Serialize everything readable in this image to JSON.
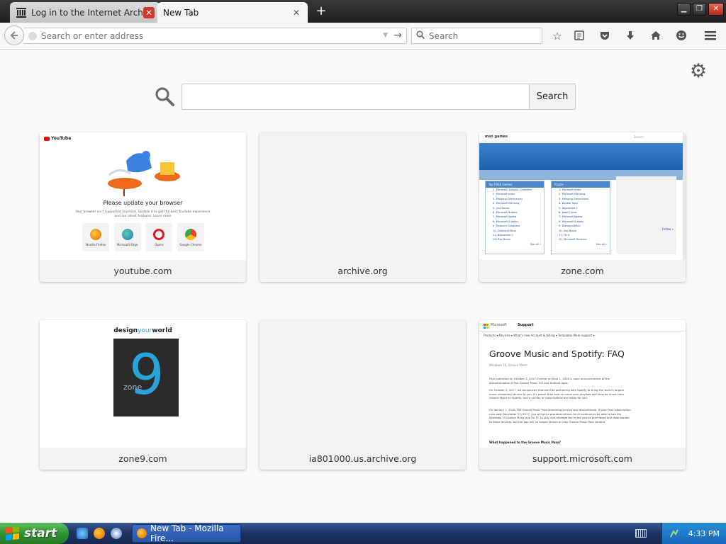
{
  "window": {
    "tabs": [
      {
        "label": "Log in to the Internet Archive",
        "icon": "archive-building-icon",
        "active": false
      },
      {
        "label": "New Tab",
        "icon": null,
        "active": true
      }
    ],
    "controls": {
      "minimize": "minimize-icon",
      "maximize": "restore-icon",
      "close": "close-icon"
    }
  },
  "toolbar": {
    "url_placeholder": "Search or enter address",
    "search_placeholder": "Search",
    "icons": [
      "back-arrow-icon",
      "bookmark-star-icon",
      "reading-list-icon",
      "pocket-icon",
      "downloads-icon",
      "home-icon",
      "hello-icon",
      "hamburger-menu-icon"
    ]
  },
  "newtab": {
    "search_button": "Search",
    "settings_icon": "gear-icon",
    "tiles": [
      {
        "title": "youtube.com"
      },
      {
        "title": "archive.org"
      },
      {
        "title": "zone.com"
      },
      {
        "title": "zone9.com"
      },
      {
        "title": "ia801000.us.archive.org"
      },
      {
        "title": "support.microsoft.com"
      }
    ],
    "youtube_thumb": {
      "brand": "YouTube",
      "heading": "Please update your browser",
      "sub": "Your browser isn't supported anymore. Update it to get the best YouTube experience and our latest features. Learn more",
      "browsers": [
        "Mozilla Firefox",
        "Microsoft Edge",
        "Opera",
        "Google Chrome"
      ]
    },
    "zone_thumb": {
      "logo": "msn games",
      "search": "Search",
      "col1_head": "Top FREE Games",
      "col1_items": [
        "1. Microsoft Solitaire Collection",
        "2. Microsoft Jewel",
        "3. Mahjong Dimensions",
        "4. Microsoft Mahjong",
        "5. Just Words",
        "6. Microsoft Bubble",
        "7. Microsoft Jigsaw",
        "8. Microsoft Sudoku",
        "9. Treasure Conquest",
        "10. Diamond Mine",
        "11. Bejeweled 2",
        "12. Zoo Boom"
      ],
      "col1_more": "See all »",
      "col2_head": "Puzzle",
      "col2_items": [
        "1. Microsoft Jewel",
        "2. Microsoft Mahjong",
        "3. Mahjong Dimensions",
        "4. Bubble Town",
        "5. Bejeweled 2",
        "6. Jewel Quest",
        "7. Microsoft Jigsaw",
        "8. Microsoft Sudoku",
        "9. Diamond Mine",
        "10. Zoo Boom",
        "11. Fill it",
        "12. Microsoft Treasure"
      ],
      "col2_more": "See all »",
      "side_link": "Follow »"
    },
    "zone9_thumb": {
      "title_a": "design",
      "title_b": "your",
      "title_c": "world",
      "nine": "9",
      "zone": "zone"
    },
    "ms_thumb": {
      "brand": "Microsoft",
      "section": "Support",
      "nav": "Products ▾   Devices ▾   What's new   Account & billing ▾   Templates   More support ▾",
      "title": "Groove Music and Spotify: FAQ",
      "meta": "Windows 10, Groove Music",
      "p1": "First published on October 2, 2017. Further on June 1, 2018 & upon announcement of the discontinuation of the Groove Music iOS and Android apps.",
      "p2": "On October 2, 2017, we announced that we'd be partnering with Spotify to bring the world's largest music streaming service to you. It's easier than ever to move your playlists and favorite music from Groove Music to Spotify, and a variety of subscriptions are ready for you.",
      "p3": "On January 1, 2018, the Groove Music Pass streaming service was discontinued. If your Pass subscription runs past December 31, 2017, you will get a prorated refund. You'll continue to be able to use the Windows 10 Groove Music app for PC to play and manage the music you've purchased and downloaded to these devices, but the app will no longer stream or play Groove Music Pass content.",
      "q": "What happened to the Groove Music Pass?"
    }
  },
  "taskbar": {
    "start": "start",
    "quicklaunch": [
      "internet-explorer-icon",
      "firefox-icon",
      "media-player-icon"
    ],
    "active_window": "New Tab - Mozilla Fire...",
    "clock": "4:33 PM"
  }
}
